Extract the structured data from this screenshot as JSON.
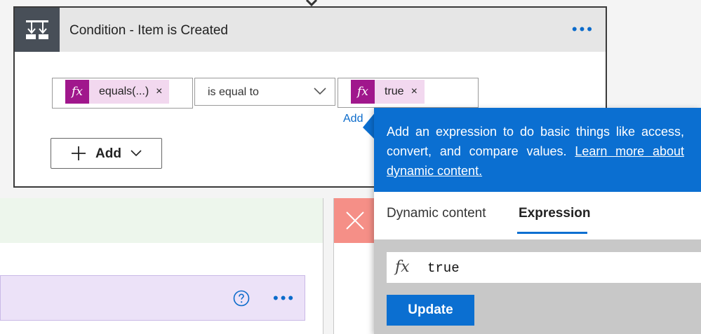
{
  "condition": {
    "title": "Condition - Item is Created",
    "more": "•••",
    "left_token": {
      "icon": "fx",
      "label": "equals(...)",
      "remove": "×"
    },
    "operator": "is equal to",
    "right_token": {
      "icon": "fx",
      "label": "true",
      "remove": "×"
    },
    "add_link": "Add",
    "add_button": "Add"
  },
  "action_card": {
    "more": "•••"
  },
  "popup": {
    "info_text": "Add an expression to do basic things like access, convert, and compare values.",
    "info_link": "Learn more about dynamic content.",
    "tabs": [
      "Dynamic content",
      "Expression"
    ],
    "active_tab": "Expression",
    "expression_icon": "fx",
    "expression_value": "true",
    "update_button": "Update"
  },
  "colors": {
    "accent": "#0b6fd1",
    "token_icon": "#a0178c",
    "token_bg": "#f2d8ef",
    "condition_header": "#484f58",
    "no_branch": "#f58f87",
    "yes_branch": "#edf6ec"
  }
}
